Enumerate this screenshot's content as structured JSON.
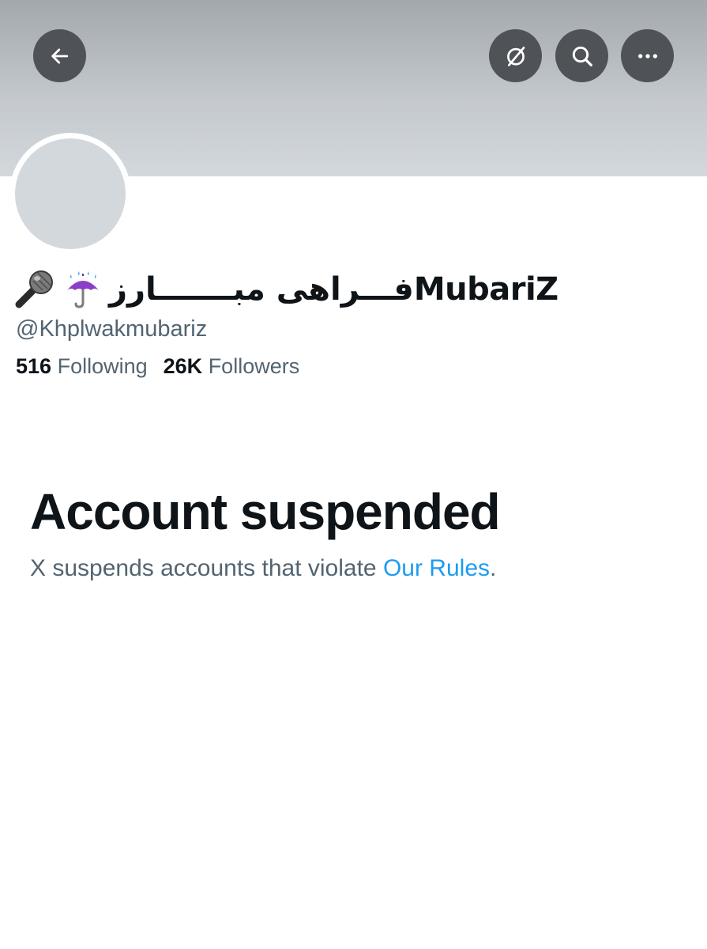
{
  "profile": {
    "display_name": "فـــراهی مبـــــــارزMubariZ",
    "emoji_1": "microphone-icon",
    "emoji_2": "umbrella-with-rain-icon",
    "handle": "@Khplwakmubariz",
    "following_count": "516",
    "following_label": "Following",
    "followers_count": "26K",
    "followers_label": "Followers"
  },
  "header_buttons": {
    "back": "back-arrow-icon",
    "grok": "grok-icon",
    "search": "search-icon",
    "more": "more-options-icon"
  },
  "suspension": {
    "title": "Account suspended",
    "message_prefix": "X suspends accounts that violate ",
    "link_text": "Our Rules",
    "message_suffix": "."
  },
  "colors": {
    "link": "#1d9bf0",
    "secondary_text": "#536471",
    "primary_text": "#0f1419",
    "button_bg": "#4f5357"
  }
}
